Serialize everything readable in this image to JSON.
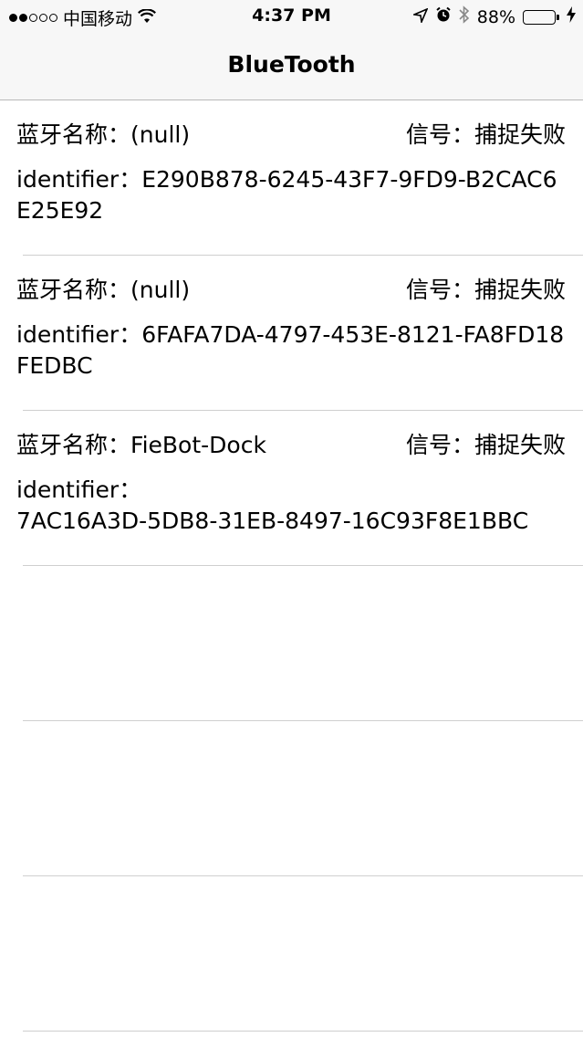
{
  "status_bar": {
    "carrier": "中国移动",
    "signal_icon": "signal-dots-icon",
    "wifi_icon": "wifi-icon",
    "time": "4:37 PM",
    "location_icon": "location-arrow-icon",
    "alarm_icon": "alarm-icon",
    "bluetooth_icon": "bluetooth-icon",
    "battery_percent": "88%",
    "battery_level": 0.88,
    "battery_color": "#4cd964",
    "charging_icon": "charging-bolt-icon"
  },
  "nav": {
    "title": "BlueTooth"
  },
  "devices": [
    {
      "name_label": "蓝牙名称：",
      "name": "(null)",
      "signal_label": "信号：",
      "signal": "捕捉失败",
      "identifier_label": "identifier：",
      "identifier": "E290B878-6245-43F7-9FD9-B2CAC6E25E92"
    },
    {
      "name_label": "蓝牙名称：",
      "name": "(null)",
      "signal_label": "信号：",
      "signal": "捕捉失败",
      "identifier_label": "identifier：",
      "identifier": "6FAFA7DA-4797-453E-8121-FA8FD18FEDBC"
    },
    {
      "name_label": "蓝牙名称：",
      "name": "FieBot-Dock",
      "signal_label": "信号：",
      "signal": "捕捉失败",
      "identifier_label": "identifier：",
      "identifier": "7AC16A3D-5DB8-31EB-8497-16C93F8E1BBC"
    }
  ]
}
